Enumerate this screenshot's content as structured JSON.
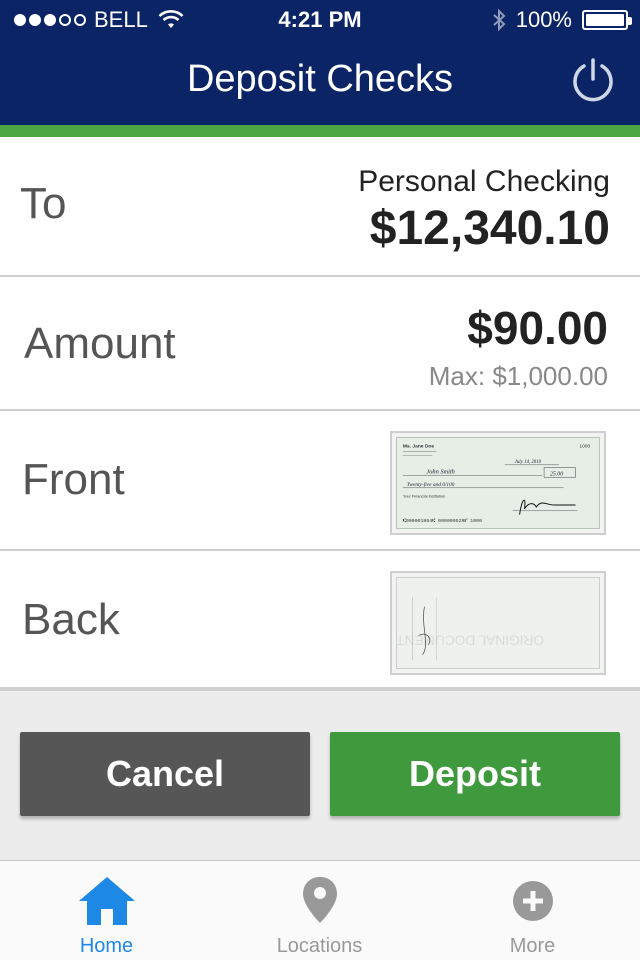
{
  "status_bar": {
    "carrier": "BELL",
    "time": "4:21 PM",
    "battery": "100%"
  },
  "header": {
    "title": "Deposit Checks",
    "power_icon": "power-icon"
  },
  "form": {
    "to": {
      "label": "To",
      "account": "Personal Checking",
      "balance": "$12,340.10"
    },
    "amount": {
      "label": "Amount",
      "value": "$90.00",
      "max": "Max: $1,000.00"
    },
    "front": {
      "label": "Front",
      "check": {
        "payer": "Ms. Jane Doe",
        "number": "1000",
        "payee": "John Smith",
        "amount": "25.00",
        "written": "Twenty-five and 0/100",
        "date": "July 14, 2010",
        "micr": "⑆000001864⑆ 000000529⑈ 1000",
        "bank": "Your Financial Institution"
      }
    },
    "back": {
      "label": "Back",
      "watermark": "ORIGINAL DOCUMENT"
    }
  },
  "actions": {
    "cancel": "Cancel",
    "deposit": "Deposit"
  },
  "tabs": [
    {
      "label": "Home",
      "icon": "home-icon",
      "active": true
    },
    {
      "label": "Locations",
      "icon": "location-pin-icon",
      "active": false
    },
    {
      "label": "More",
      "icon": "plus-circle-icon",
      "active": false
    }
  ],
  "colors": {
    "header_bg": "#0a2466",
    "accent_green": "#4ca644",
    "deposit_button": "#3e9a3c",
    "cancel_button": "#565656",
    "active_tab": "#1e88e5"
  }
}
